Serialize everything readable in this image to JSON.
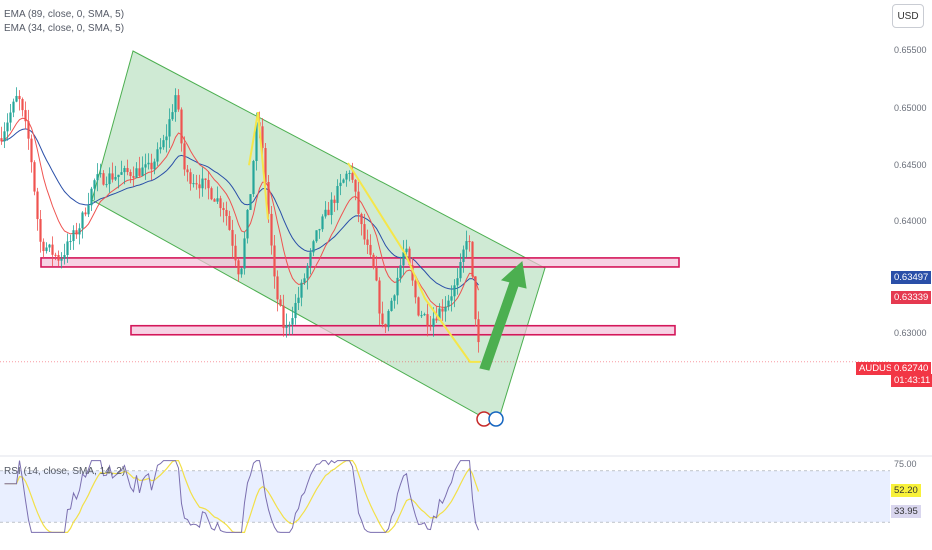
{
  "indicators": {
    "ema1": "EMA (89, close, 0, SMA, 5)",
    "ema2": "EMA (34, close, 0, SMA, 5)",
    "rsi": "RSI (14, close, SMA, 14, 2)"
  },
  "currency_button": "USD",
  "colors": {
    "background": "#ffffff",
    "panel_tint": "#e9efff",
    "channel_fill": "#a8d8b0",
    "zone_border": "#d4175a",
    "zone_fill": "#f3bfd8",
    "up_candle": "#26a69a",
    "down_candle": "#ef5350",
    "ema89": "#2a4fa8",
    "ema34": "#ef5350",
    "zigzag": "#f5e64a",
    "arrow": "#4caf50",
    "rsi_line": "#7b6fb0",
    "rsi_ma": "#f2e048",
    "ema89_badge": "#2a4fa8",
    "ema34_badge": "#e53950",
    "price_badge": "#f23645",
    "rsi_ma_badge": "#f8f13a",
    "rsi_badge": "#d9d6ee"
  },
  "chart_data": {
    "type": "candlestick",
    "symbol": "AUDUSD",
    "price_axis": {
      "ticks": [
        "0.65500",
        "0.65000",
        "0.64500",
        "0.64000",
        "0.63000"
      ],
      "range": [
        0.6218,
        0.6598
      ]
    },
    "current_price": "0.62740",
    "countdown": "01:43:11",
    "ema89_value": "0.63497",
    "ema34_value": "0.63339",
    "rsi": {
      "ticks": [
        "75.00"
      ],
      "ma_value": "52.20",
      "value": "33.95",
      "range": [
        20,
        80
      ],
      "bands": [
        70,
        30
      ]
    },
    "price_levels": {
      "support": [
        0.6298,
        0.6306
      ],
      "resistance": [
        0.6358,
        0.6366
      ]
    },
    "candles_summary": {
      "start_price": 0.6472,
      "high": 0.6515,
      "low": 0.6274,
      "last": 0.6274,
      "count": 160
    }
  }
}
